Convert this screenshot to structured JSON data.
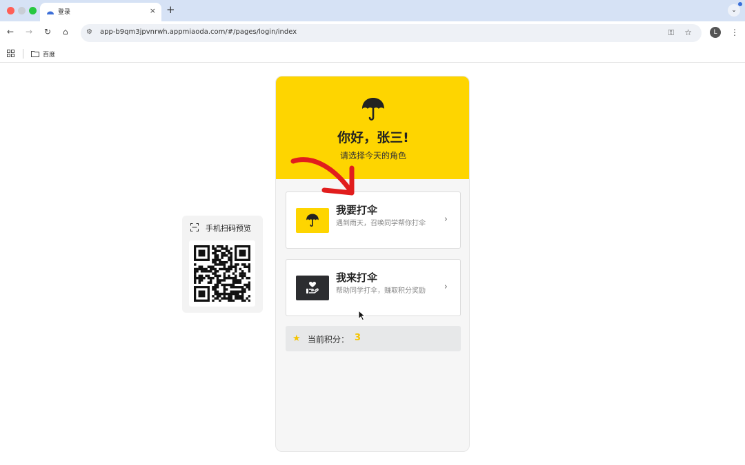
{
  "browser": {
    "tab_title": "登录",
    "tab_close": "×",
    "new_tab": "+",
    "url": "app-b9qm3jpvnrwh.appmiaoda.com/#/pages/login/index",
    "profile_initial": "L",
    "bookmark_label": "百度"
  },
  "qr": {
    "title": "手机扫码预览"
  },
  "hero": {
    "greeting": "你好，张三!",
    "subtitle": "请选择今天的角色"
  },
  "cards": [
    {
      "title": "我要打伞",
      "desc": "遇到雨天，召唤同学帮你打伞",
      "chevron": "›"
    },
    {
      "title": "我来打伞",
      "desc": "帮助同学打伞，赚取积分奖励",
      "chevron": "›"
    }
  ],
  "points": {
    "label": "当前积分：",
    "value": "3"
  },
  "colors": {
    "brand_yellow": "#fed500",
    "dark": "#2c2d30",
    "annotation_red": "#e11d1d"
  }
}
